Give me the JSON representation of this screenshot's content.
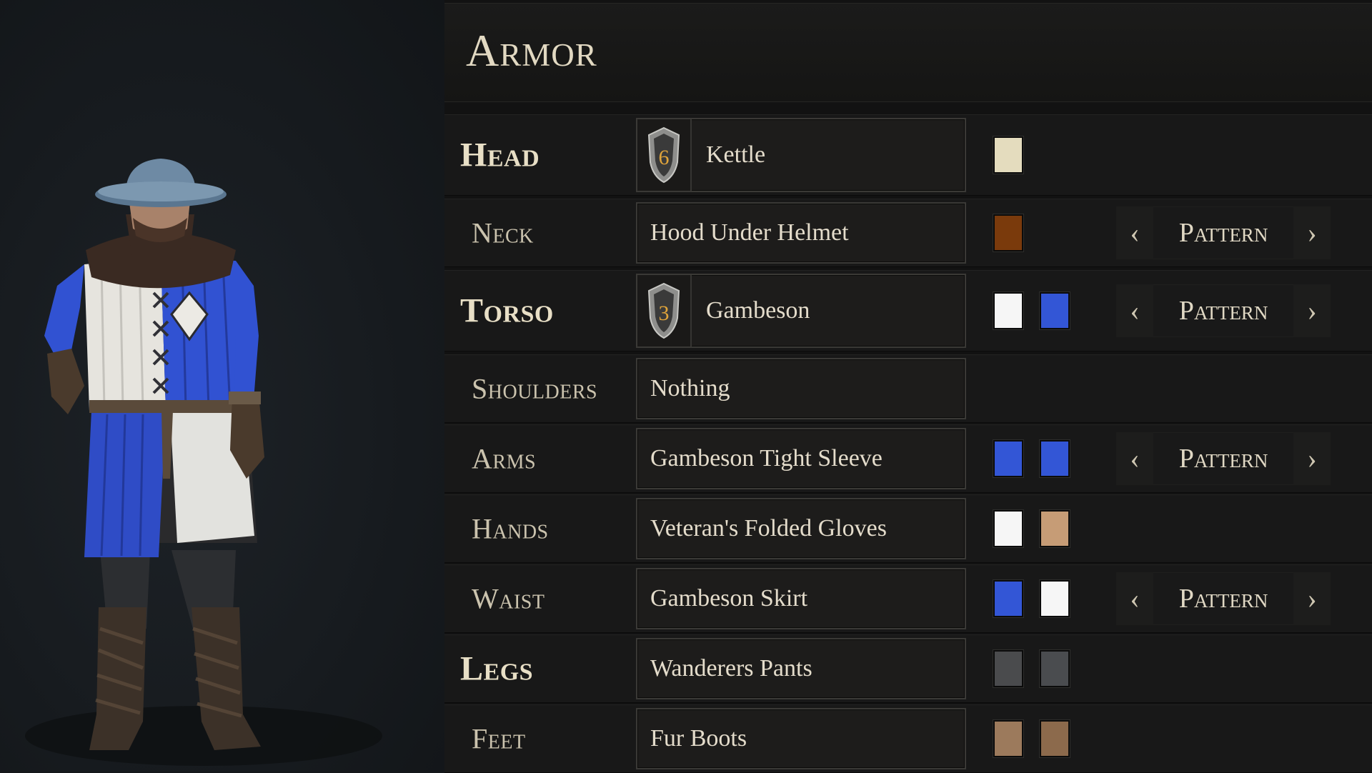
{
  "panel": {
    "title": "Armor"
  },
  "slots": [
    {
      "key": "head",
      "label": "Head",
      "item": "Kettle",
      "tier": "6",
      "colors": [
        "#e4dcbe"
      ],
      "pattern": null
    },
    {
      "key": "neck",
      "label": "Neck",
      "item": "Hood Under Helmet",
      "colors": [
        "#7a3a0c"
      ],
      "pattern": "Pattern"
    },
    {
      "key": "torso",
      "label": "Torso",
      "item": "Gambeson",
      "tier": "3",
      "colors": [
        "#f6f6f6",
        "#3356d6"
      ],
      "pattern": "Pattern"
    },
    {
      "key": "shoulders",
      "label": "Shoulders",
      "item": "Nothing",
      "colors": [],
      "pattern": null
    },
    {
      "key": "arms",
      "label": "Arms",
      "item": "Gambeson Tight Sleeve",
      "colors": [
        "#3356d6",
        "#3356d6"
      ],
      "pattern": "Pattern"
    },
    {
      "key": "hands",
      "label": "Hands",
      "item": "Veteran's Folded Gloves",
      "colors": [
        "#f6f6f6",
        "#c69c76"
      ],
      "pattern": null
    },
    {
      "key": "waist",
      "label": "Waist",
      "item": "Gambeson Skirt",
      "colors": [
        "#3356d6",
        "#f6f6f6"
      ],
      "pattern": "Pattern"
    },
    {
      "key": "legs",
      "label": "Legs",
      "item": "Wanderers Pants",
      "colors": [
        "#4a4b4d",
        "#4a4c4f"
      ],
      "pattern": null
    },
    {
      "key": "feet",
      "label": "Feet",
      "item": "Fur Boots",
      "colors": [
        "#9c7a5c",
        "#8c6a4c"
      ],
      "pattern": null
    }
  ],
  "icons": {
    "tier": "shield-icon",
    "prev": "chevron-left-icon",
    "next": "chevron-right-icon"
  },
  "theme": {
    "accent_gold": "#e0a43a",
    "text": "#d9d1bd"
  }
}
